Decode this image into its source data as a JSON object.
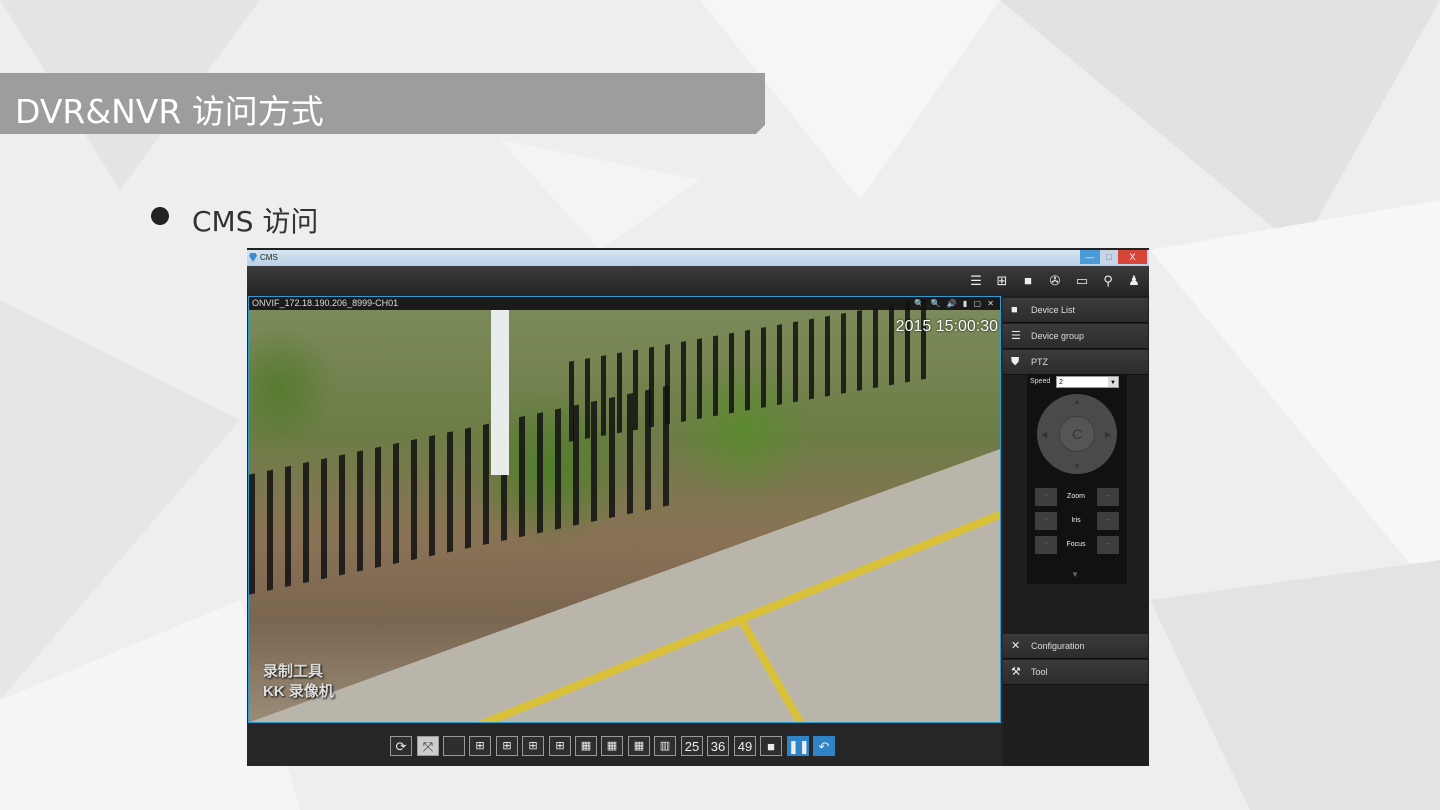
{
  "slide": {
    "title": "DVR&NVR 访问方式",
    "bullet": "CMS 访问"
  },
  "app": {
    "window_title": "CMS",
    "window_buttons": [
      "—",
      "□",
      "X"
    ],
    "toolbar_icons": [
      "list-icon",
      "network-icon",
      "camera-icon",
      "reel-icon",
      "monitor-icon",
      "key-icon",
      "alarm-icon"
    ],
    "video": {
      "channel": "ONVIF_172.18.190.206_8999-CH01",
      "controls": "🔍 🔍 🔊 ▮ ▢ ✕",
      "timestamp": "2015 15:00:30",
      "watermark": [
        "录制工具",
        "KK 录像机"
      ]
    },
    "panel": {
      "items": [
        {
          "label": "Device List",
          "icon": "camera-icon"
        },
        {
          "label": "Device group",
          "icon": "list-icon"
        },
        {
          "label": "PTZ",
          "icon": "shield-icon"
        },
        {
          "label": "Configuration",
          "icon": "tools-icon"
        },
        {
          "label": "Tool",
          "icon": "wrench-icon"
        }
      ],
      "ptz": {
        "speed_label": "Speed",
        "speed_value": "2",
        "center": "C",
        "zoom": "Zoom",
        "iris": "Iris",
        "focus": "Focus"
      }
    },
    "bottom": {
      "n25": "25",
      "n36": "36",
      "n49": "49"
    }
  }
}
